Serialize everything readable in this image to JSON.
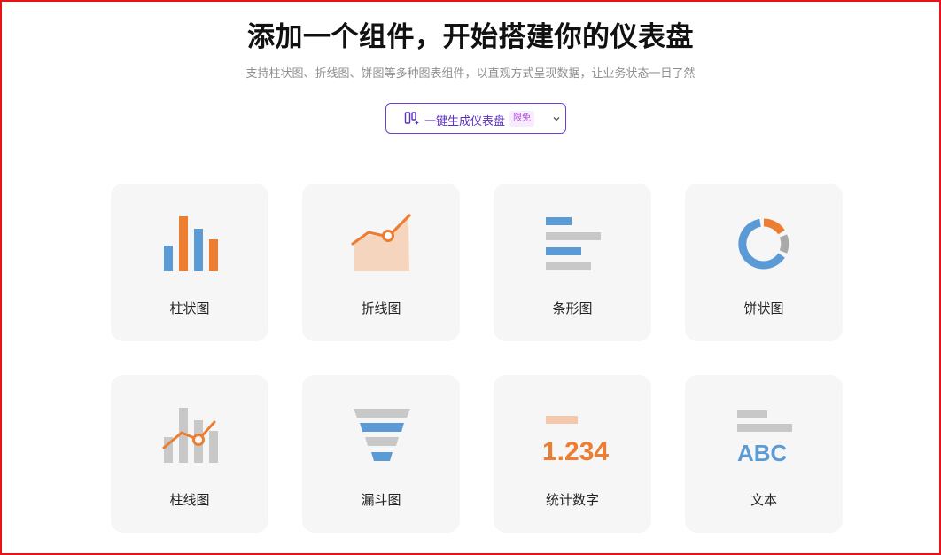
{
  "header": {
    "title": "添加一个组件，开始搭建你的仪表盘",
    "subtitle": "支持柱状图、折线图、饼图等多种图表组件，以直观方式呈现数据，让业务状态一目了然"
  },
  "generate_button": {
    "label": "一键生成仪表盘",
    "badge": "限免",
    "icon": "magic-dashboard-icon",
    "accent_color": "#6d3fd1"
  },
  "components": [
    {
      "label": "柱状图",
      "icon": "bar-chart-icon"
    },
    {
      "label": "折线图",
      "icon": "line-chart-icon"
    },
    {
      "label": "条形图",
      "icon": "horizontal-bar-chart-icon"
    },
    {
      "label": "饼状图",
      "icon": "pie-chart-icon"
    },
    {
      "label": "柱线图",
      "icon": "bar-line-chart-icon"
    },
    {
      "label": "漏斗图",
      "icon": "funnel-chart-icon"
    },
    {
      "label": "统计数字",
      "icon": "statistic-number-icon",
      "sample_value": "1.234"
    },
    {
      "label": "文本",
      "icon": "text-icon",
      "sample_text": "ABC"
    }
  ],
  "colors": {
    "blue": "#5b9bd5",
    "orange": "#ed7d31",
    "light_orange": "#f4c9ab",
    "gray": "#c8c8c8",
    "frame_border": "#e8131a"
  }
}
